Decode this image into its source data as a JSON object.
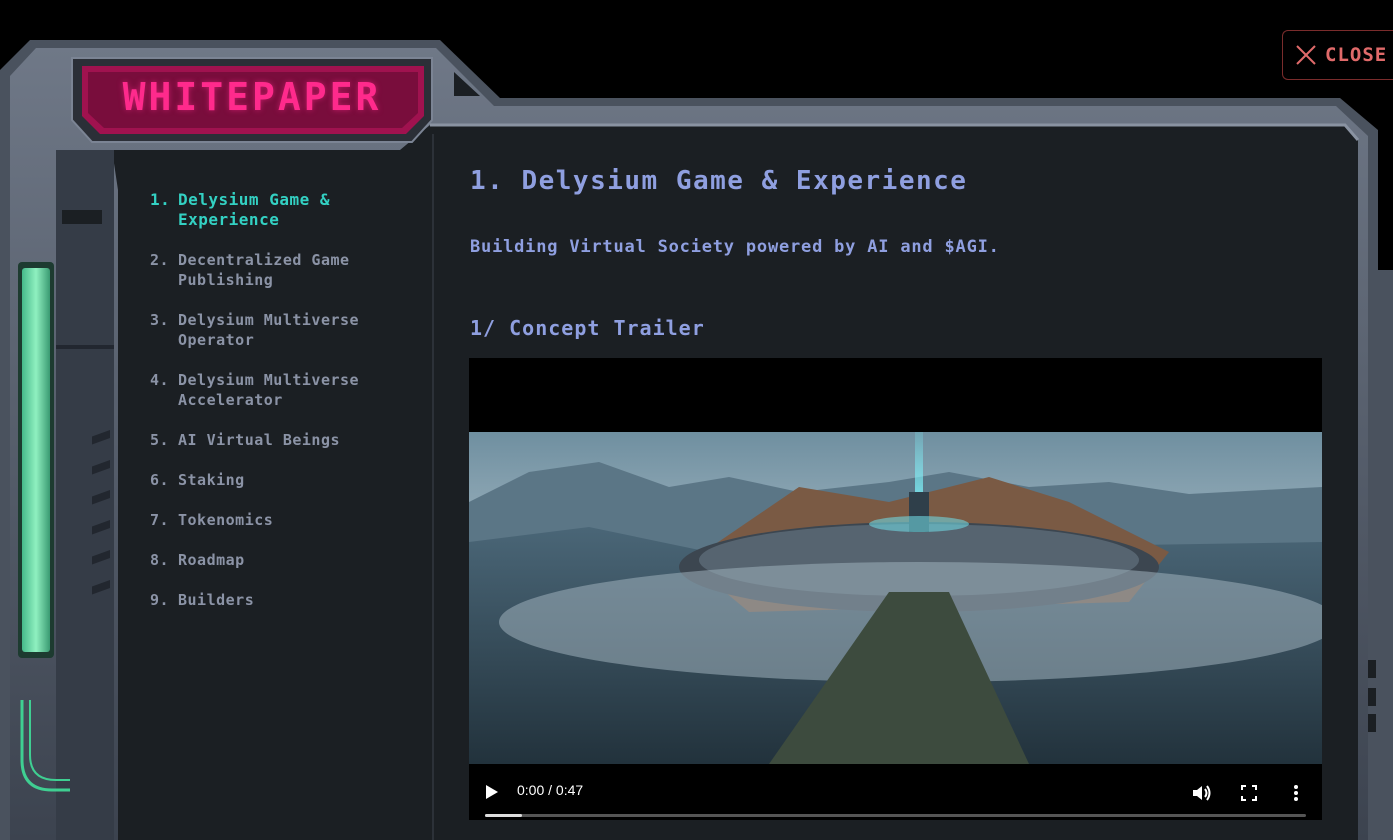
{
  "window": {
    "badge_title": "WHITEPAPER",
    "close_label": "CLOSE"
  },
  "toc": {
    "items": [
      {
        "num": "1.",
        "label": "Delysium Game & Experience",
        "active": true
      },
      {
        "num": "2.",
        "label": "Decentralized Game Publishing",
        "active": false
      },
      {
        "num": "3.",
        "label": "Delysium Multiverse Operator",
        "active": false
      },
      {
        "num": "4.",
        "label": "Delysium Multiverse Accelerator",
        "active": false
      },
      {
        "num": "5.",
        "label": "AI Virtual Beings",
        "active": false
      },
      {
        "num": "6.",
        "label": "Staking",
        "active": false
      },
      {
        "num": "7.",
        "label": "Tokenomics",
        "active": false
      },
      {
        "num": "8.",
        "label": "Roadmap",
        "active": false
      },
      {
        "num": "9.",
        "label": "Builders",
        "active": false
      }
    ]
  },
  "content": {
    "title": "1. Delysium Game & Experience",
    "subtitle": "Building Virtual Society powered by AI and $AGI.",
    "section_title": "1/ Concept Trailer"
  },
  "video": {
    "time": "0:00 / 0:47",
    "progress_fraction": 0.045
  },
  "colors": {
    "accent_active": "#33d1c3",
    "heading": "#8f9fe0",
    "badge": "#ff2a8c",
    "close": "#e06a6a"
  }
}
